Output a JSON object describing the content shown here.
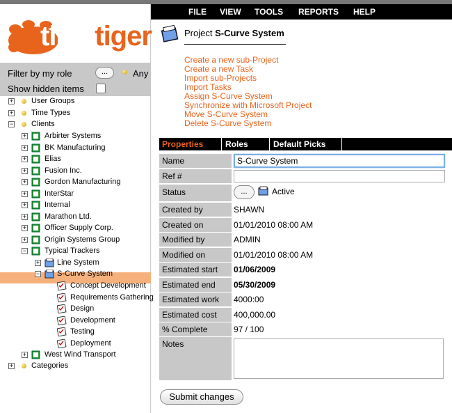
{
  "menu": [
    "FILE",
    "VIEW",
    "TOOLS",
    "REPORTS",
    "HELP"
  ],
  "logo": {
    "time": "time",
    "tiger": "tiger"
  },
  "filter": {
    "role_label": "Filter by my role",
    "role_button": "...",
    "role_value": "Any",
    "hidden_label": "Show hidden items"
  },
  "tree": {
    "user_groups": "User Groups",
    "time_types": "Time Types",
    "clients": "Clients",
    "client_items": [
      "Arbirter Systems",
      "BK Manufacturing",
      "Elias",
      "Fusion Inc.",
      "Gordon Manufacturing",
      "InterStar",
      "Internal",
      "Marathon Ltd.",
      "Officer Supply Corp.",
      "Origin Systems Group",
      "Typical Trackers"
    ],
    "tt_children": [
      "Line System",
      "S-Curve System"
    ],
    "tasks": [
      "Concept Development",
      "Requirements Gathering",
      "Design",
      "Development",
      "Testing",
      "Deployment"
    ],
    "west_wind": "West Wind Transport",
    "categories": "Categories",
    "expand_plus": "+",
    "expand_minus": "−"
  },
  "project": {
    "prefix": "Project",
    "name": "S-Curve System"
  },
  "actions": [
    "Create a new sub-Project",
    "Create a new Task",
    "Import sub-Projects",
    "Import Tasks",
    "Assign S-Curve System",
    "Synchronize with Microsoft Project",
    "Move S-Curve System",
    "Delete S-Curve System"
  ],
  "tabs": [
    "Properties",
    "Roles",
    "Default Picks"
  ],
  "colors": {
    "accent": "#e8641c",
    "selected_row": "#f6b07c",
    "label_bg": "#c8c8c8"
  },
  "form": {
    "labels": {
      "name": "Name",
      "ref": "Ref #",
      "status": "Status",
      "created_by": "Created by",
      "created_on": "Created on",
      "modified_by": "Modified by",
      "modified_on": "Modified on",
      "est_start": "Estimated start",
      "est_end": "Estimated end",
      "est_work": "Estimated work",
      "est_cost": "Estimated cost",
      "pct": "% Complete",
      "notes": "Notes"
    },
    "values": {
      "name": "S-Curve System",
      "ref": "",
      "status_button": "...",
      "status": "Active",
      "created_by": "SHAWN",
      "created_on": "01/01/2010 08:00 AM",
      "modified_by": "ADMIN",
      "modified_on": "01/01/2010 08:00 AM",
      "est_start": "01/06/2009",
      "est_end": "05/30/2009",
      "est_work": "4000:00",
      "est_cost": "400,000.00",
      "pct": "97 / 100",
      "notes": ""
    }
  },
  "submit": "Submit changes"
}
